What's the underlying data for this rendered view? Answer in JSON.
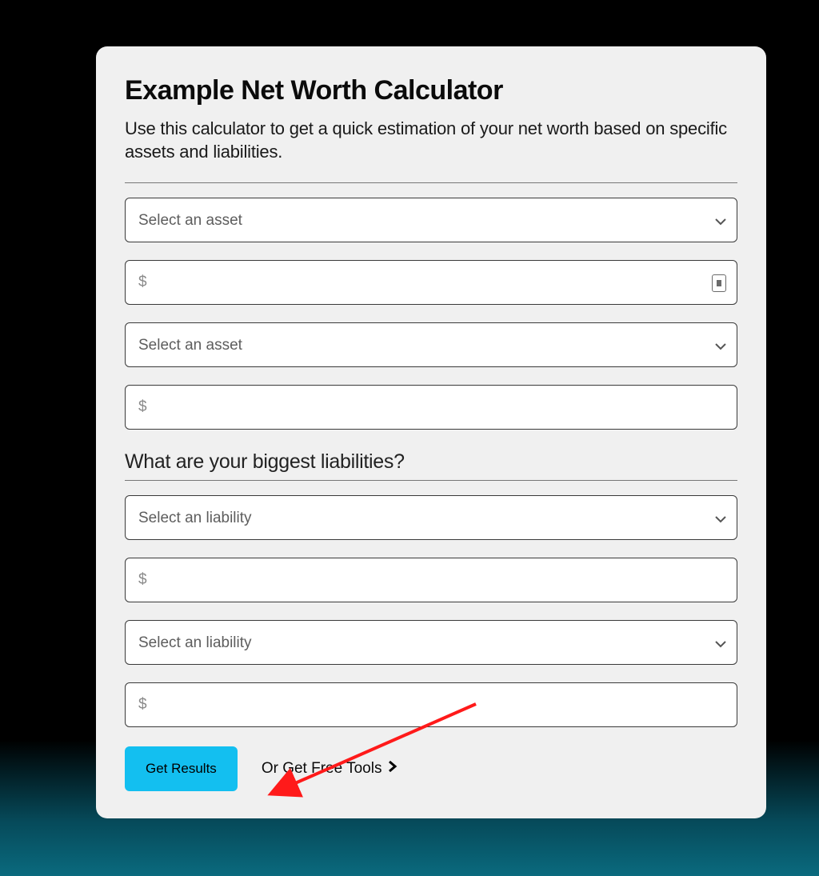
{
  "card": {
    "title": "Example Net Worth Calculator",
    "subtitle": "Use this calculator to get a quick estimation of your net worth based on specific assets and liabilities."
  },
  "form": {
    "asset_select_placeholder": "Select an asset",
    "amount_placeholder": "$",
    "liabilities_heading": "What are your biggest liabilities?",
    "liability_select_placeholder": "Select an liability"
  },
  "buttons": {
    "primary": "Get Results",
    "link": "Or Get Free Tools"
  },
  "annotation": {
    "arrow_color": "#ff1a1a"
  }
}
